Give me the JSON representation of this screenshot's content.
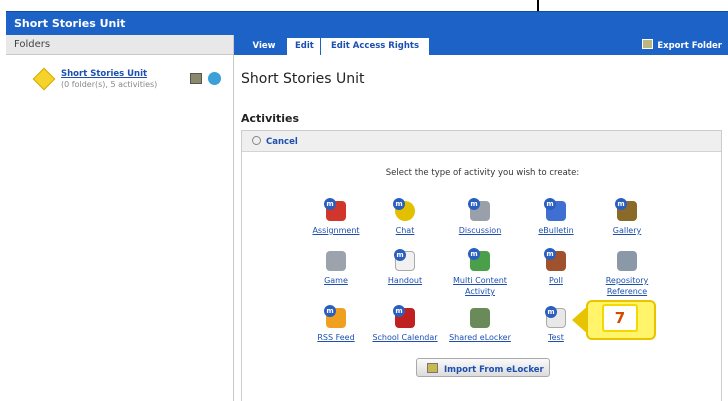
{
  "app": {
    "title": "Short Stories Unit"
  },
  "left": {
    "header": "Folders",
    "folder": {
      "name": "Short Stories Unit",
      "detail": "(0 folder(s), 5 activities)"
    }
  },
  "tabs": [
    {
      "label": "View"
    },
    {
      "label": "Edit"
    },
    {
      "label": "Edit Access Rights"
    }
  ],
  "toolbar": {
    "export": "Export Folder"
  },
  "main": {
    "title": "Short Stories Unit",
    "section": "Activities",
    "cancel": "Cancel",
    "prompt": "Select the type of activity you wish to create:",
    "activities": [
      {
        "label": "Assignment",
        "color": "#d0362b"
      },
      {
        "label": "Chat",
        "color": "#e2c000"
      },
      {
        "label": "Discussion",
        "color": "#9aa0aa"
      },
      {
        "label": "eBulletin",
        "color": "#3f6fd1"
      },
      {
        "label": "Gallery",
        "color": "#8a6a28"
      },
      {
        "label": "Game",
        "color": "#9ca3ad"
      },
      {
        "label": "Handout",
        "color": "#f1f1f1"
      },
      {
        "label": "Multi Content",
        "label2": "Activity",
        "color": "#4aa04a"
      },
      {
        "label": "Poll",
        "color": "#a0522d"
      },
      {
        "label": "Repository",
        "label2": "Reference",
        "color": "#8a98a8"
      },
      {
        "label": "RSS Feed",
        "color": "#f0a020"
      },
      {
        "label": "School Calendar",
        "color": "#c02020"
      },
      {
        "label": "Shared eLocker",
        "color": "#6a8a5a"
      },
      {
        "label": "Test",
        "color": "#e8e8e8"
      }
    ],
    "import_button": "Import From eLocker"
  },
  "callout": {
    "number": "7"
  }
}
